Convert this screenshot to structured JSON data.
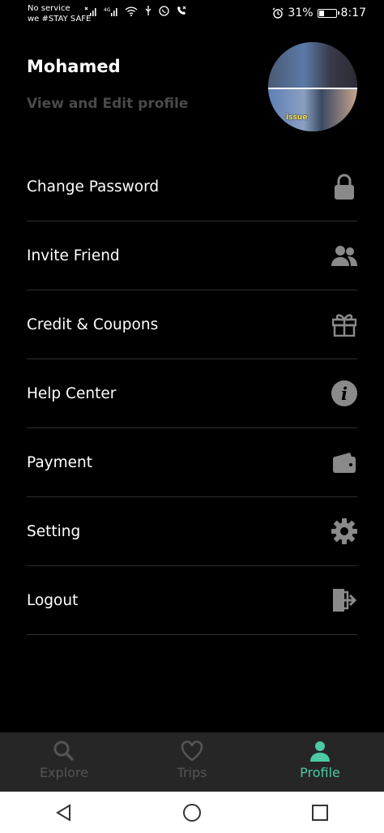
{
  "status_bar": {
    "carrier_line1": "No service",
    "carrier_line2": "we #STAY SAFE",
    "network": "4G",
    "battery": "31%",
    "battery_level": 0.31,
    "time": "8:17"
  },
  "profile": {
    "name": "Mohamed",
    "edit_label": "View and Edit profile",
    "avatar_caption": "issue"
  },
  "menu": {
    "items": [
      {
        "label": "Change Password",
        "icon": "lock-icon"
      },
      {
        "label": "Invite Friend",
        "icon": "users-icon"
      },
      {
        "label": "Credit & Coupons",
        "icon": "gift-icon"
      },
      {
        "label": "Help Center",
        "icon": "info-icon"
      },
      {
        "label": "Payment",
        "icon": "wallet-icon"
      },
      {
        "label": "Setting",
        "icon": "gear-icon"
      },
      {
        "label": "Logout",
        "icon": "logout-icon"
      }
    ]
  },
  "bottom_nav": {
    "items": [
      {
        "label": "Explore",
        "icon": "search-icon",
        "active": false
      },
      {
        "label": "Trips",
        "icon": "heart-icon",
        "active": false
      },
      {
        "label": "Profile",
        "icon": "person-icon",
        "active": true
      }
    ]
  },
  "colors": {
    "background": "#000000",
    "accent": "#4ec9a6",
    "muted": "#555555",
    "icon": "#8a8a8a"
  }
}
